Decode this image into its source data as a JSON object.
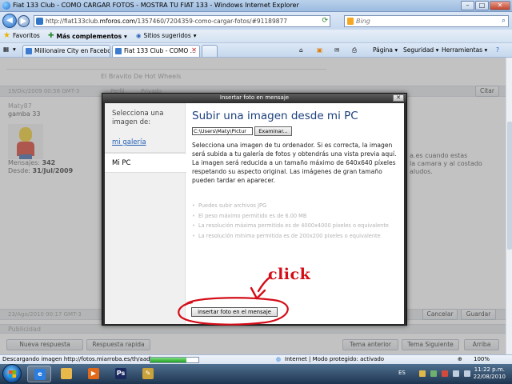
{
  "window": {
    "title": "Fiat 133 Club - COMO CARGAR FOTOS - MOSTRA TU FIAT 133 - Windows Internet Explorer",
    "min": "–",
    "max": "□",
    "close": "✕"
  },
  "address": {
    "url_prefix": "http://fiat133club.",
    "url_domain": "mforos.com",
    "url_rest": "/1357460/7204359-como-cargar-fotos/#91189877",
    "search_placeholder": "Bing"
  },
  "favorites": {
    "label": "Favoritos",
    "more": "Más complementos",
    "suggested": "Sitios sugeridos"
  },
  "tabs": [
    {
      "label": "Millionaire City en Facebook"
    },
    {
      "label": "Fiat 133 Club - COMO ..."
    }
  ],
  "commandbar": {
    "page": "Página",
    "safety": "Seguridad",
    "tools": "Herramientas"
  },
  "forum": {
    "breadcrumb": "El Bravito De Hot Wheels",
    "post_date": "19/Dic/2009 00:58 GMT-3",
    "quote_button": "Citar",
    "profile": "Perfil",
    "private": "Privado",
    "username": "Maty87",
    "rank": "gamba 33",
    "posts_label": "Mensajes:",
    "posts_value": "342",
    "since_label": "Desde:",
    "since_value": "31/Jul/2009",
    "post_text_1": "a.es cuando estas",
    "post_text_2": "la camara y al costado",
    "post_text_3": "aludos.",
    "post_date_2": "23/Ago/2010 00:17 GMT-3",
    "cancel": "Cancelar",
    "save": "Guardar",
    "ads": "Publicidad",
    "new_reply": "Nueva respuesta",
    "quick_reply": "Respuesta rapida",
    "prev_topic": "Tema anterior",
    "next_topic": "Tema Siguiente",
    "top": "Arriba"
  },
  "modal": {
    "title": "Insertar foto en mensaje",
    "close": "✕",
    "side_heading": "Selecciona una imagen de:",
    "side_gallery": "mi galería",
    "side_pc": "Mi PC",
    "heading": "Subir una imagen desde mi PC",
    "file_value": "C:\\Users\\Maty\\Pictur",
    "browse": "Examinar...",
    "desc": "Selecciona una imagen de tu ordenador. Si es correcta, la imagen será subida a tu galería de fotos y obtendrás una vista previa aquí. La imagen será reducida a un tamaño máximo de 640x640 píxeles respetando su aspecto original. Las imágenes de gran tamaño pueden tardar en aparecer.",
    "bullets": [
      "Puedes subir archivos JPG",
      "El peso máximo permitido es de 6.00 MB",
      "La resolución máxima permitida es de 4000x4000 píxeles o equivalente",
      "La resolución mínima permitida es de 200x200 píxeles o equivalente"
    ],
    "submit": "insertar foto en el mensaje"
  },
  "annotation": {
    "label": "click",
    "color": "#d40d18"
  },
  "status": {
    "downloading": "Descargando imagen http://fotos.miarroba.es/th/aadb/...",
    "progress_percent": 75,
    "zone": "Internet | Modo protegido: activado",
    "zoom": "100%"
  },
  "taskbar": {
    "lang": "ES",
    "time": "11:22 p.m.",
    "date": "22/08/2010",
    "apps": [
      {
        "icon": "internet-explorer-icon",
        "glyph": "e",
        "color": "#2b7de0"
      },
      {
        "icon": "folder-icon",
        "glyph": "",
        "color": "#e8b84a"
      },
      {
        "icon": "media-player-icon",
        "glyph": "▶",
        "color": "#e06a1a"
      },
      {
        "icon": "photoshop-icon",
        "glyph": "Ps",
        "color": "#1a2a5e"
      },
      {
        "icon": "paint-icon",
        "glyph": "✎",
        "color": "#c9a23a"
      }
    ]
  }
}
